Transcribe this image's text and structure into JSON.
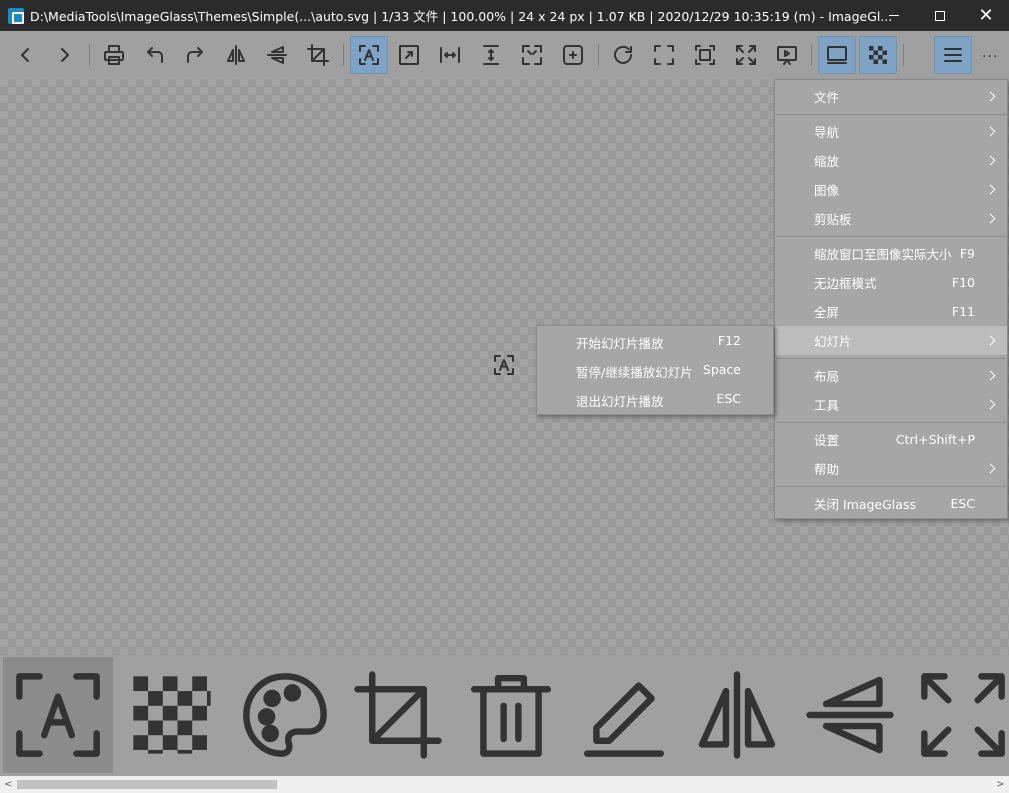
{
  "window": {
    "title": "D:\\MediaTools\\ImageGlass\\Themes\\Simple(...\\auto.svg  |  1/33 文件  |  100.00%  |  24 x 24 px  |  1.07 KB  |  2020/12/29 10:35:19 (m)  - ImageGl...",
    "close_glyph": "✕"
  },
  "toolbar": {
    "buttons": [
      {
        "name": "view-previous-icon"
      },
      {
        "name": "view-next-icon"
      },
      {
        "name": "print-icon"
      },
      {
        "name": "rotate-left-icon"
      },
      {
        "name": "rotate-right-icon"
      },
      {
        "name": "flip-horizontal-icon"
      },
      {
        "name": "flip-vertical-icon"
      },
      {
        "name": "crop-icon"
      },
      {
        "name": "auto-zoom-icon",
        "active": true
      },
      {
        "name": "lock-zoom-ratio-icon"
      },
      {
        "name": "scale-to-width-icon"
      },
      {
        "name": "scale-to-height-icon"
      },
      {
        "name": "scale-to-fit-icon"
      },
      {
        "name": "scale-to-fill-icon"
      },
      {
        "name": "refresh-icon"
      },
      {
        "name": "frameless-icon"
      },
      {
        "name": "fullscreen-icon"
      },
      {
        "name": "adjust-window-icon"
      },
      {
        "name": "slideshow-icon"
      },
      {
        "name": "thumbnail-bar-icon",
        "active": true
      },
      {
        "name": "checkerboard-icon",
        "active": true
      },
      {
        "name": "main-menu-icon",
        "active": true
      }
    ],
    "more": "..."
  },
  "main_menu": {
    "items": [
      {
        "label": "文件",
        "shortcut": "",
        "submenu": true
      },
      {
        "label": "导航",
        "shortcut": "",
        "submenu": true
      },
      {
        "label": "缩放",
        "shortcut": "",
        "submenu": true
      },
      {
        "label": "图像",
        "shortcut": "",
        "submenu": true
      },
      {
        "label": "剪贴板",
        "shortcut": "",
        "submenu": true
      },
      {
        "label": "缩放窗口至图像实际大小",
        "shortcut": "F9",
        "submenu": false
      },
      {
        "label": "无边框模式",
        "shortcut": "F10",
        "submenu": false
      },
      {
        "label": "全屏",
        "shortcut": "F11",
        "submenu": false
      },
      {
        "label": "幻灯片",
        "shortcut": "",
        "submenu": true,
        "highlighted": true
      },
      {
        "label": "布局",
        "shortcut": "",
        "submenu": true
      },
      {
        "label": "工具",
        "shortcut": "",
        "submenu": true
      },
      {
        "label": "设置",
        "shortcut": "Ctrl+Shift+P",
        "submenu": false
      },
      {
        "label": "帮助",
        "shortcut": "",
        "submenu": true
      },
      {
        "label": "关闭 ImageGlass",
        "shortcut": "ESC",
        "submenu": false
      }
    ]
  },
  "slideshow_submenu": {
    "items": [
      {
        "label": "开始幻灯片播放",
        "shortcut": "F12"
      },
      {
        "label": "暂停/继续播放幻灯片",
        "shortcut": "Space"
      },
      {
        "label": "退出幻灯片播放",
        "shortcut": "ESC"
      }
    ]
  },
  "thumbnails": [
    {
      "name": "auto-zoom-icon",
      "selected": true
    },
    {
      "name": "checkerboard-icon"
    },
    {
      "name": "color-picker-icon"
    },
    {
      "name": "crop-icon"
    },
    {
      "name": "delete-icon"
    },
    {
      "name": "edit-icon"
    },
    {
      "name": "flip-horizontal-icon"
    },
    {
      "name": "flip-vertical-icon"
    },
    {
      "name": "fullscreen-icon"
    }
  ],
  "scrollbar": {
    "left_arrow": "<",
    "right_arrow": ">"
  },
  "colors": {
    "titlebar": "#2b2b2b",
    "toolbar": "#a0a0a0",
    "active_button": "#7ea3c4",
    "menu_background": "#a6a6a6",
    "menu_highlight": "#bcbcbc",
    "icon_stroke": "#333333"
  }
}
